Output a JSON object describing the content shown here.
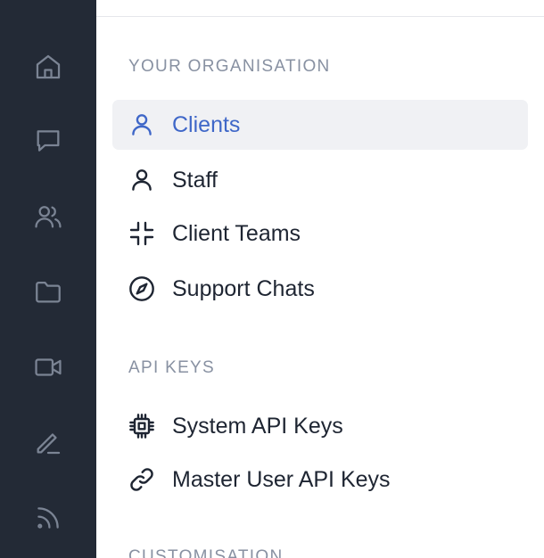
{
  "rail": {
    "items": [
      {
        "icon": "home-icon"
      },
      {
        "icon": "chat-icon"
      },
      {
        "icon": "users-icon"
      },
      {
        "icon": "folder-icon"
      },
      {
        "icon": "video-icon"
      },
      {
        "icon": "pencil-icon"
      },
      {
        "icon": "rss-icon"
      }
    ]
  },
  "sections": {
    "organisation": {
      "heading": "YOUR ORGANISATION",
      "items": [
        {
          "label": "Clients",
          "icon": "user-icon",
          "active": true
        },
        {
          "label": "Staff",
          "icon": "user-icon",
          "active": false
        },
        {
          "label": "Client Teams",
          "icon": "collapse-icon",
          "active": false
        },
        {
          "label": "Support Chats",
          "icon": "compass-icon",
          "active": false
        }
      ]
    },
    "api_keys": {
      "heading": "API KEYS",
      "items": [
        {
          "label": "System API Keys",
          "icon": "chip-icon"
        },
        {
          "label": "Master User API Keys",
          "icon": "link-icon"
        }
      ]
    },
    "customisation": {
      "heading": "CUSTOMISATION"
    }
  },
  "colors": {
    "rail_bg": "#232a36",
    "accent": "#3f67c8",
    "active_bg": "#f0f1f4",
    "text": "#1e2532",
    "heading": "#8891a2"
  }
}
